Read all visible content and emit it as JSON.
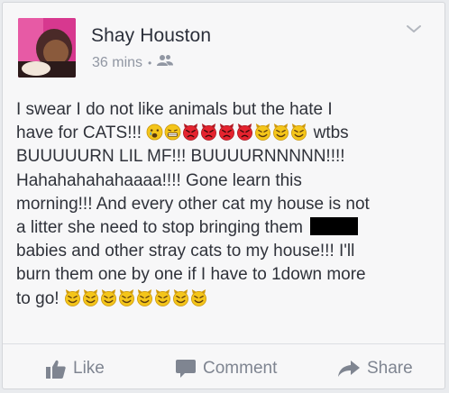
{
  "post": {
    "author_name": "Shay Houston",
    "timestamp": "36 mins",
    "separator": "•",
    "privacy_icon": "friends-icon",
    "menu_icon": "chevron-down-icon",
    "lines": {
      "l1": "I swear I do not like animals but the hate I",
      "l2a": "have for CATS!!!",
      "l2b": "wtbs",
      "l3": "BUUUUURN LIL MF!!! BUUUURNNNNN!!!!",
      "l4": "Hahahahahahaaaa!!!! Gone learn this",
      "l5": "morning!!! And every other cat my house is not",
      "l6": "a litter she need to stop bringing them",
      "l7": "babies and other stray cats to my house!!! I'll",
      "l8": "burn them one by one if I have to 1down more",
      "l9": "to go!"
    },
    "emoji_row1": [
      "crying-face-emoji",
      "grimace-face-emoji",
      "angry-devil-emoji",
      "angry-devil-emoji",
      "angry-devil-emoji",
      "angry-devil-emoji",
      "smiling-devil-emoji",
      "smiling-devil-emoji",
      "smiling-devil-emoji"
    ],
    "emoji_row2": [
      "smiling-devil-emoji",
      "smiling-devil-emoji",
      "smiling-devil-emoji",
      "smiling-devil-emoji",
      "smiling-devil-emoji",
      "smiling-devil-emoji",
      "smiling-devil-emoji",
      "smiling-devil-emoji"
    ]
  },
  "actions": {
    "like_label": "Like",
    "comment_label": "Comment",
    "share_label": "Share"
  },
  "colors": {
    "card_background": "#f7f7f8",
    "text": "#2f323a",
    "muted": "#7f8591",
    "emoji_yellow": "#f4c51a",
    "emoji_red": "#e4232e"
  }
}
